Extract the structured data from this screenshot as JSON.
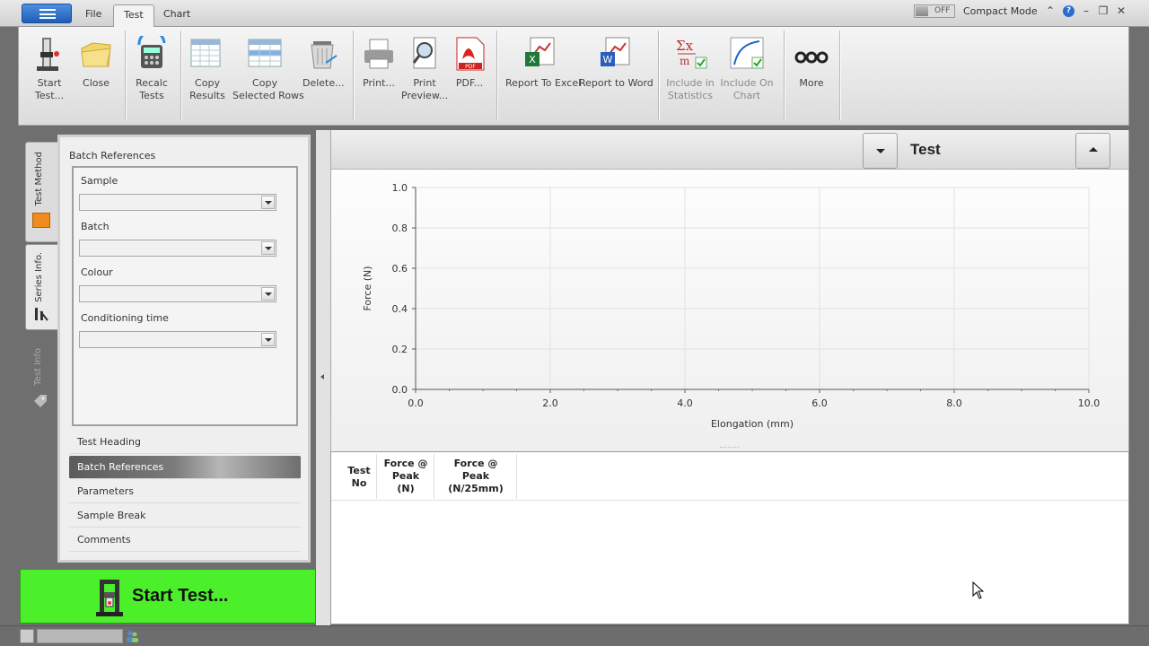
{
  "titlebar": {
    "tabs": [
      {
        "label": "File"
      },
      {
        "label": "Test"
      },
      {
        "label": "Chart"
      }
    ],
    "toggle_state": "OFF",
    "compact_mode": "Compact Mode"
  },
  "ribbon": {
    "buttons": [
      {
        "label_1": "Start",
        "label_2": "Test...",
        "icon": "tester-icon"
      },
      {
        "label_1": "",
        "label_2": "Close",
        "icon": "folder-icon"
      },
      {
        "label_1": "Recalc",
        "label_2": "Tests",
        "icon": "recalc-icon"
      },
      {
        "label_1": "Copy",
        "label_2": "Results",
        "icon": "copy-grid-icon"
      },
      {
        "label_1": "Copy",
        "label_2": "Selected Rows",
        "icon": "copy-rows-icon"
      },
      {
        "label_1": "",
        "label_2": "Delete...",
        "icon": "trash-icon"
      },
      {
        "label_1": "",
        "label_2": "Print...",
        "icon": "printer-icon"
      },
      {
        "label_1": "Print",
        "label_2": "Preview...",
        "icon": "print-preview-icon"
      },
      {
        "label_1": "",
        "label_2": "PDF...",
        "icon": "pdf-icon"
      },
      {
        "label_1": "",
        "label_2": "Report To Excel",
        "icon": "excel-icon"
      },
      {
        "label_1": "",
        "label_2": "Report to Word",
        "icon": "word-icon"
      },
      {
        "label_1": "Include in",
        "label_2": "Statistics",
        "icon": "statistics-icon"
      },
      {
        "label_1": "Include On",
        "label_2": "Chart",
        "icon": "chart-check-icon"
      },
      {
        "label_1": "",
        "label_2": "More",
        "icon": "more-icon"
      }
    ]
  },
  "vtabs": [
    {
      "label": "Test Method"
    },
    {
      "label": "Series Info."
    },
    {
      "label": "Test Info"
    }
  ],
  "left_panel": {
    "header": "Batch References",
    "fields": [
      {
        "label": "Sample",
        "value": ""
      },
      {
        "label": "Batch",
        "value": ""
      },
      {
        "label": "Colour",
        "value": ""
      },
      {
        "label": "Conditioning time",
        "value": ""
      }
    ],
    "nav": [
      {
        "label": "Test Heading"
      },
      {
        "label": "Batch References"
      },
      {
        "label": "Parameters"
      },
      {
        "label": "Sample Break"
      },
      {
        "label": "Comments"
      }
    ]
  },
  "start_button": {
    "label": "Start Test..."
  },
  "chart_header": {
    "title": "Test"
  },
  "chart_data": {
    "type": "line",
    "title": "Test",
    "xlabel": "Elongation (mm)",
    "ylabel": "Force (N)",
    "xlim": [
      0.0,
      10.0
    ],
    "ylim": [
      0.0,
      1.0
    ],
    "x_ticks": [
      "0.0",
      "2.0",
      "4.0",
      "6.0",
      "8.0",
      "10.0"
    ],
    "y_ticks": [
      "0.0",
      "0.2",
      "0.4",
      "0.6",
      "0.8",
      "1.0"
    ],
    "grid": true,
    "series": []
  },
  "results_table": {
    "columns": [
      {
        "line1": "Test",
        "line2": "No",
        "line3": ""
      },
      {
        "line1": "Force @",
        "line2": "Peak",
        "line3": "(N)"
      },
      {
        "line1": "Force @",
        "line2": "Peak",
        "line3": "(N/25mm)"
      }
    ],
    "rows": []
  },
  "colors": {
    "start_button": "#4bf02a",
    "accent_blue": "#1d5fb6",
    "statusbar": "#6d6d6d"
  }
}
